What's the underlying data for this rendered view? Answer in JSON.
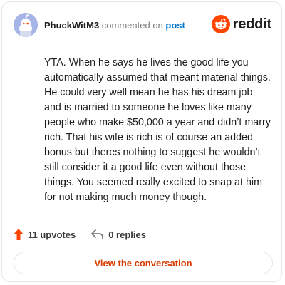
{
  "header": {
    "username": "PhuckWitM3",
    "action_text": "commented on",
    "post_link": "post"
  },
  "brand": {
    "wordmark": "reddit",
    "logo_icon": "reddit-alien-icon",
    "accent_color": "#ff4500"
  },
  "comment": {
    "body": "YTA. When he says he lives the good life you automatically assumed that meant material things. He could very well mean he has his dream job and is married to someone he loves like many people who make $50,000 a year and didn’t marry rich. That his wife is rich is of course an added bonus but theres nothing to suggest he wouldn’t still consider it a good life even without those things. You seemed really excited to snap at him for not making much money though."
  },
  "actions": {
    "upvotes": "11 upvotes",
    "upvote_icon": "upvote-arrow-icon",
    "replies": "0 replies",
    "reply_icon": "reply-arrow-icon"
  },
  "cta": {
    "label": "View the conversation",
    "color": "#d93a00"
  }
}
